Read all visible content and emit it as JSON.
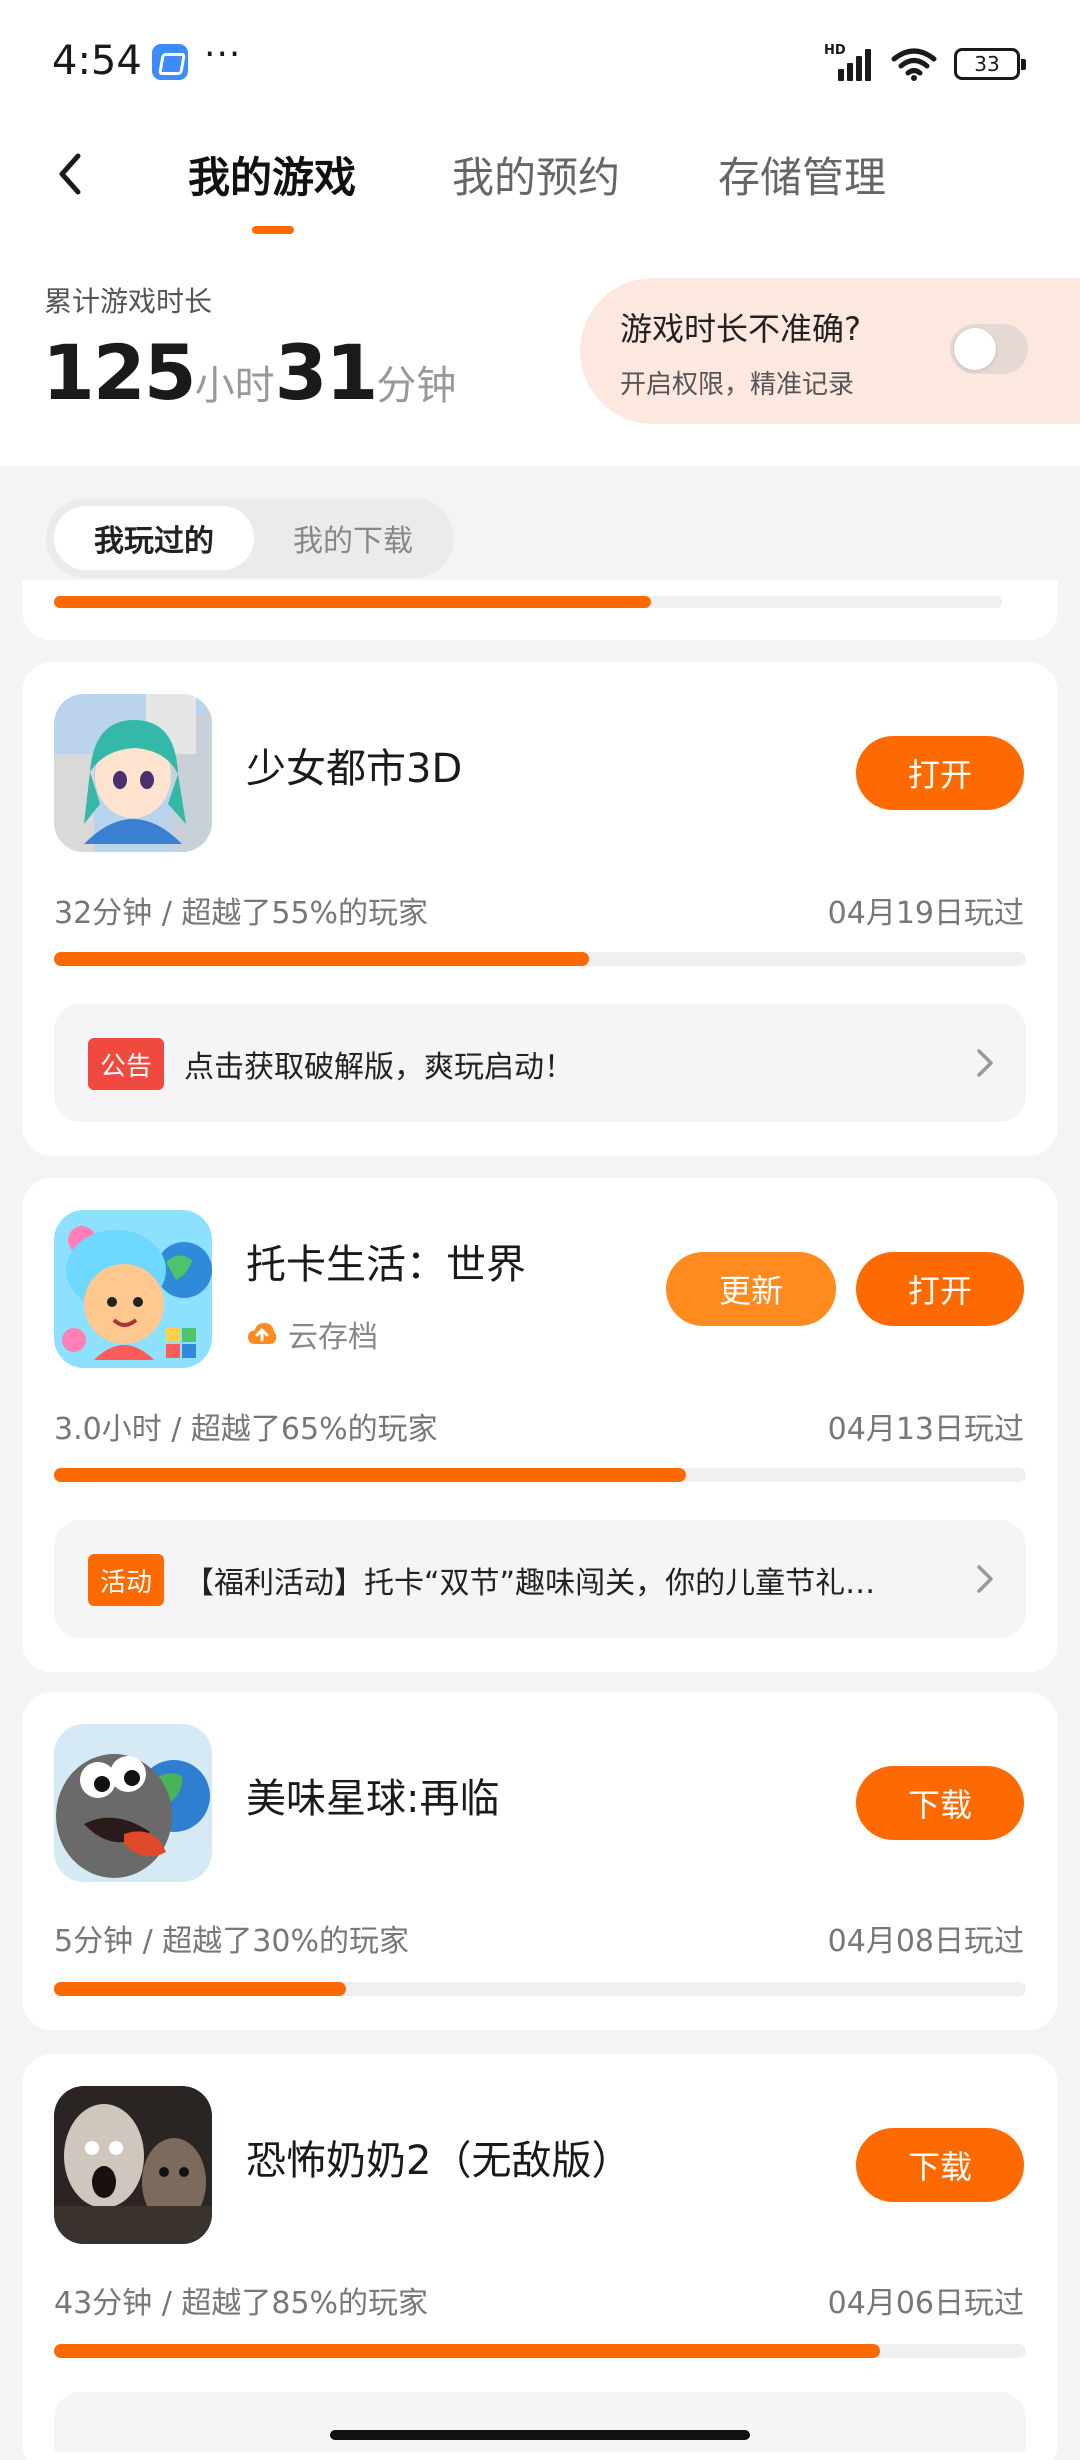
{
  "status": {
    "time": "4:54",
    "network_label": "HD",
    "battery": "33",
    "more": "···"
  },
  "nav": {
    "tabs": [
      {
        "label": "我的游戏",
        "active": true
      },
      {
        "label": "我的预约",
        "active": false
      },
      {
        "label": "存储管理",
        "active": false
      }
    ],
    "accent": "#ff6a00"
  },
  "summary": {
    "label": "累计游戏时长",
    "hours": "125",
    "hours_unit": "小时",
    "minutes": "31",
    "minutes_unit": "分钟",
    "accuracy_title": "游戏时长不准确?",
    "accuracy_sub": "开启权限，精准记录",
    "toggle_on": false
  },
  "segment": {
    "active": "我玩过的",
    "inactive": "我的下载"
  },
  "partial_card_progress": 0.63,
  "games": [
    {
      "title": "少女都市3D",
      "buttons": {
        "open": "打开"
      },
      "stats": "32分钟 / 超越了55%的玩家",
      "played": "04月19日玩过",
      "progress": 0.55,
      "notice": {
        "badge": "公告",
        "badge_color": "#f04a3e",
        "text": "点击获取破解版，爽玩启动！"
      }
    },
    {
      "title": "托卡生活：世界",
      "cloud_save": "云存档",
      "buttons": {
        "update": "更新",
        "open": "打开"
      },
      "stats": "3.0小时 / 超越了65%的玩家",
      "played": "04月13日玩过",
      "progress": 0.65,
      "notice": {
        "badge": "活动",
        "badge_color": "#ff6a00",
        "text": "【福利活动】托卡“双节”趣味闯关，你的儿童节礼…"
      }
    },
    {
      "title": "美味星球:再临",
      "buttons": {
        "download": "下载"
      },
      "stats": "5分钟 / 超越了30%的玩家",
      "played": "04月08日玩过",
      "progress": 0.3
    },
    {
      "title": "恐怖奶奶2（无敌版）",
      "buttons": {
        "download": "下载"
      },
      "stats": "43分钟 / 超越了85%的玩家",
      "played": "04月06日玩过",
      "progress": 0.85
    }
  ]
}
